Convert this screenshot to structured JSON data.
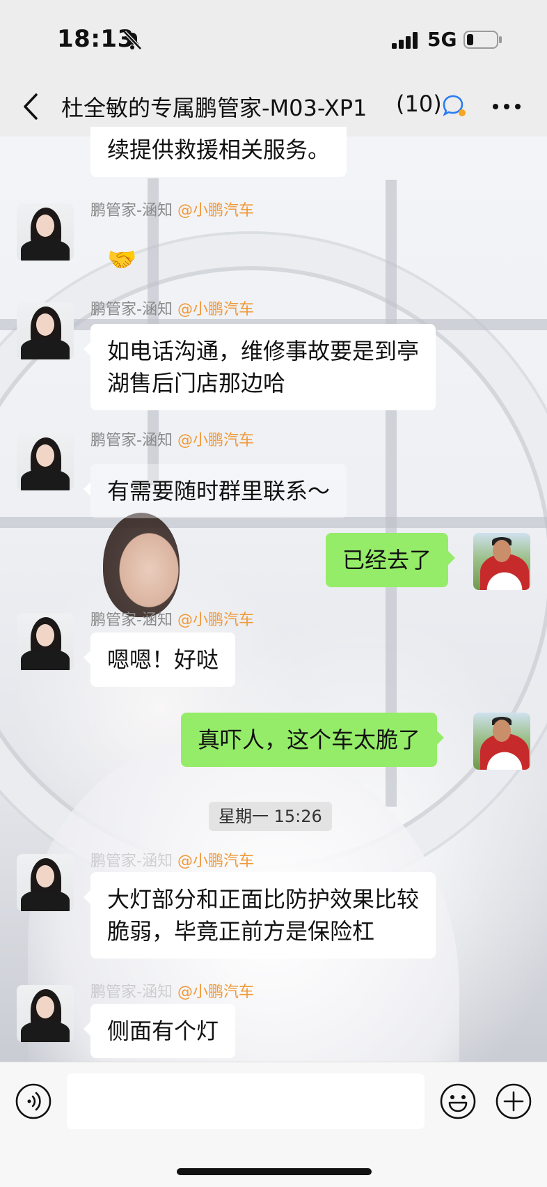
{
  "status_bar": {
    "time": "18:13",
    "network": "5G",
    "icons": [
      "bell-muted-icon",
      "signal-icon",
      "battery-icon"
    ]
  },
  "nav": {
    "title": "杜全敏的专属鹏管家-M03-XP1",
    "member_count": "(10)",
    "icons": [
      "back-icon",
      "chat-badge-icon",
      "more-icon"
    ]
  },
  "messages": [
    {
      "side": "in",
      "sender": "",
      "company": "",
      "text": "续提供救援相关服务。"
    },
    {
      "side": "in",
      "sender": "鹏管家-涵知",
      "company": "@小鹏汽车",
      "text": "🤝"
    },
    {
      "side": "in",
      "sender": "鹏管家-涵知",
      "company": "@小鹏汽车",
      "lines": [
        "如电话沟通，维修事故要是到亭",
        "湖售后门店那边哈"
      ]
    },
    {
      "side": "in",
      "sender": "鹏管家-涵知",
      "company": "@小鹏汽车",
      "text": "有需要随时群里联系～"
    },
    {
      "side": "out",
      "text": "已经去了"
    },
    {
      "side": "in",
      "sender": "鹏管家-涵知",
      "company": "@小鹏汽车",
      "text": "嗯嗯！好哒"
    },
    {
      "side": "out",
      "text": "真吓人，这个车太脆了"
    },
    {
      "side": "in",
      "sender": "鹏管家-涵知",
      "company": "@小鹏汽车",
      "lines": [
        "大灯部分和正面比防护效果比较",
        "脆弱，毕竟正前方是保险杠"
      ]
    },
    {
      "side": "in",
      "sender": "鹏管家-涵知",
      "company": "@小鹏汽车",
      "text": "侧面有个灯"
    }
  ],
  "timestamp": "星期一 15:26",
  "input_bar": {
    "value": "",
    "icons": [
      "voice-icon",
      "emoji-icon",
      "plus-icon"
    ]
  },
  "colors": {
    "outgoing_bubble": "#95ec69",
    "incoming_bubble": "#ffffff",
    "company_tag": "#f09a3a",
    "chrome_background": "#ededed"
  }
}
